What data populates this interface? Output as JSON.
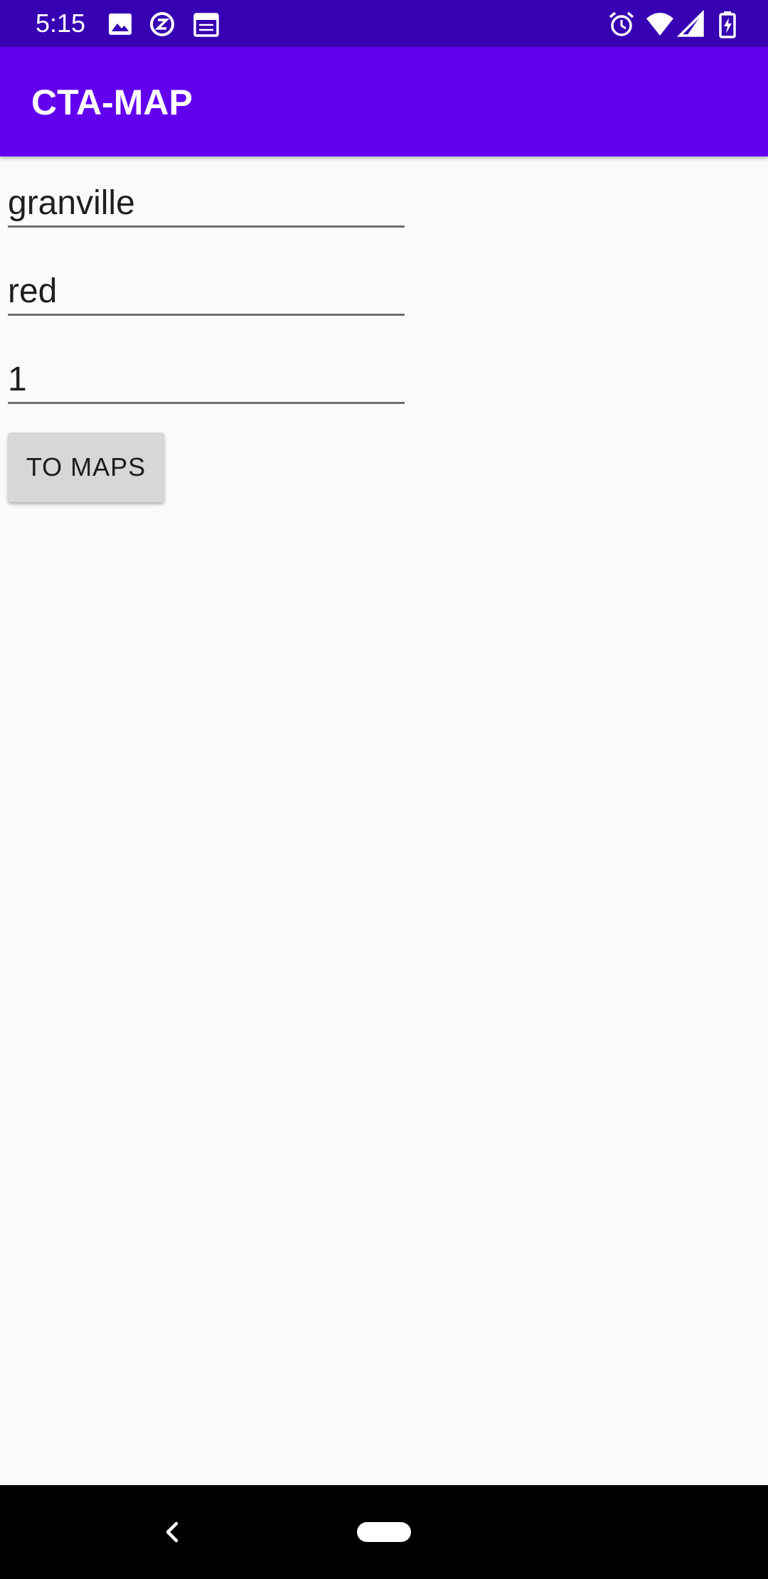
{
  "status_bar": {
    "time": "5:15",
    "icons": [
      "image-icon",
      "sync-icon",
      "calendar-icon",
      "alarm-icon",
      "wifi-icon",
      "signal-icon",
      "battery-charging-icon"
    ]
  },
  "app_bar": {
    "title": "CTA-MAP"
  },
  "form": {
    "station_value": "granville",
    "line_value": "red",
    "number_value": "1",
    "button_label": "TO MAPS"
  },
  "nav_bar": {
    "icons": [
      "back-icon",
      "home-pill"
    ]
  },
  "colors": {
    "status_bar": "#3700b3",
    "app_bar": "#6200ee",
    "background": "#fafafa",
    "button": "#d6d7d7"
  }
}
